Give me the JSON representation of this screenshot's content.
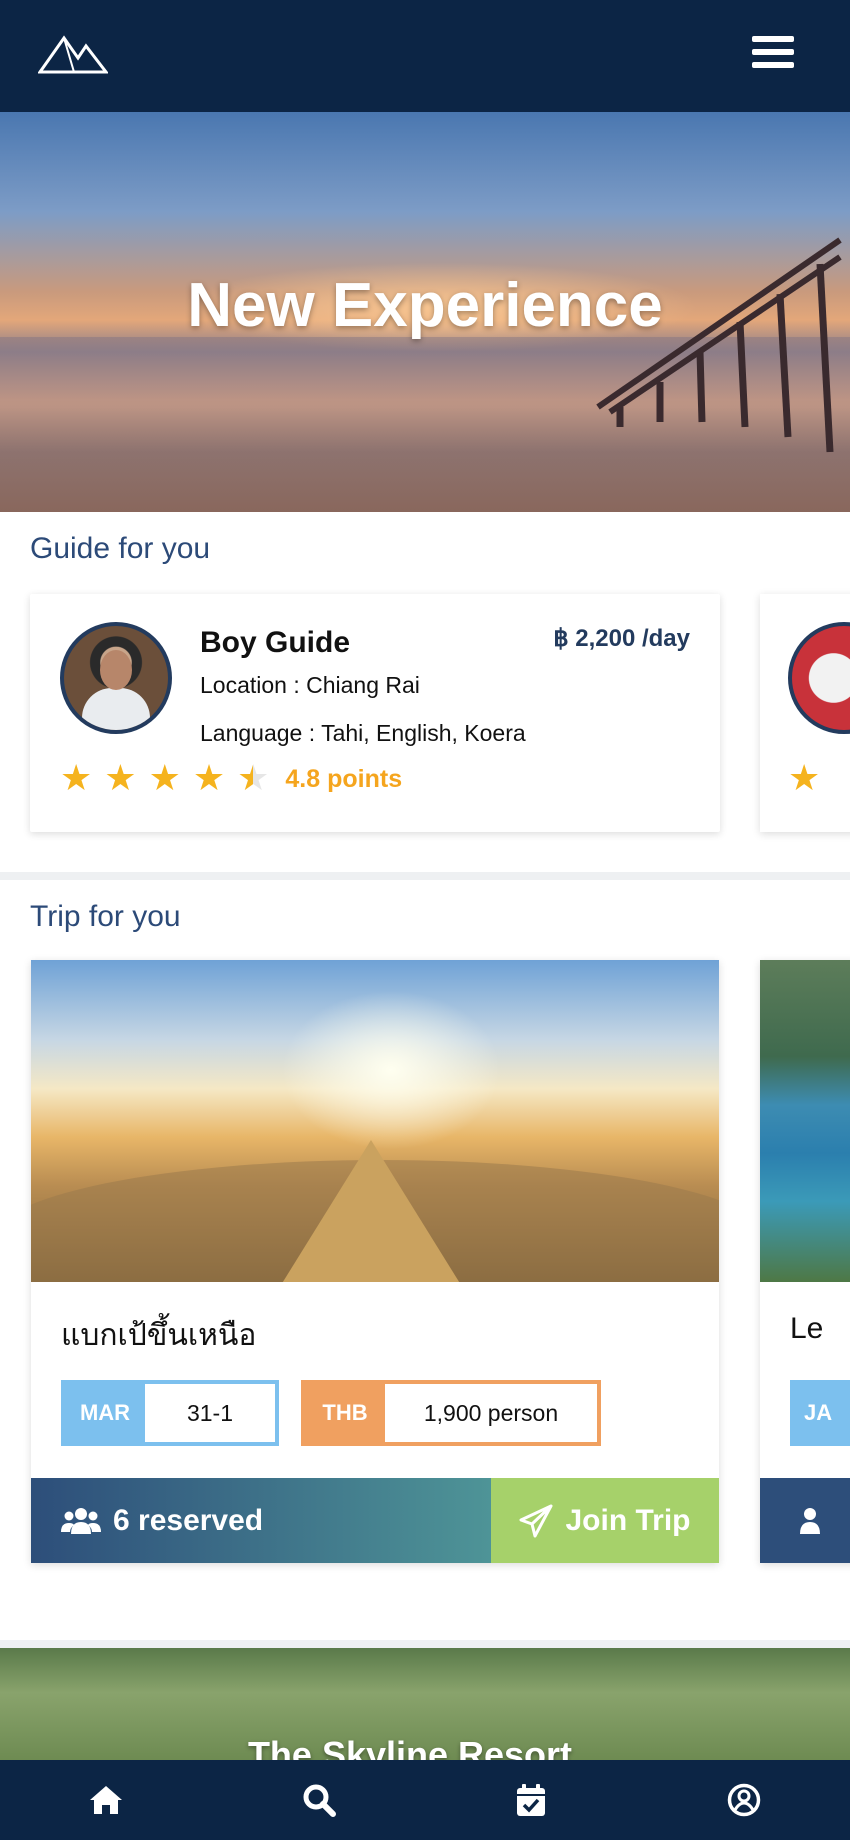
{
  "header": {
    "logo": "mountain-logo-icon",
    "menu": "hamburger-menu-icon"
  },
  "hero": {
    "title": "New Experience"
  },
  "guides": {
    "section_title": "Guide for you",
    "items": [
      {
        "name": "Boy Guide",
        "price": "฿ 2,200 /day",
        "location": "Location : Chiang Rai",
        "language": "Language : Tahi, English, Koera",
        "rating": 4.8,
        "points": "4.8 points"
      }
    ]
  },
  "trips": {
    "section_title": "Trip for you",
    "items": [
      {
        "title": "แบกเป้ขึ้นเหนือ",
        "month": "MAR",
        "dates": "31-1",
        "currency": "THB",
        "price": "1,900 person",
        "reserved": "6 reserved",
        "join_label": "Join Trip"
      },
      {
        "title": "Le",
        "month": "JA"
      }
    ]
  },
  "resort": {
    "title": "The Skyline Resort"
  },
  "bottom_nav": [
    "home-icon",
    "search-icon",
    "calendar-check-icon",
    "user-circle-icon"
  ],
  "colors": {
    "navy": "#0c2545",
    "section_title": "#2c4a78",
    "star": "#f5b31e",
    "date_tag": "#7cc0ee",
    "price_tag": "#f0a060",
    "join": "#a6d16a"
  }
}
